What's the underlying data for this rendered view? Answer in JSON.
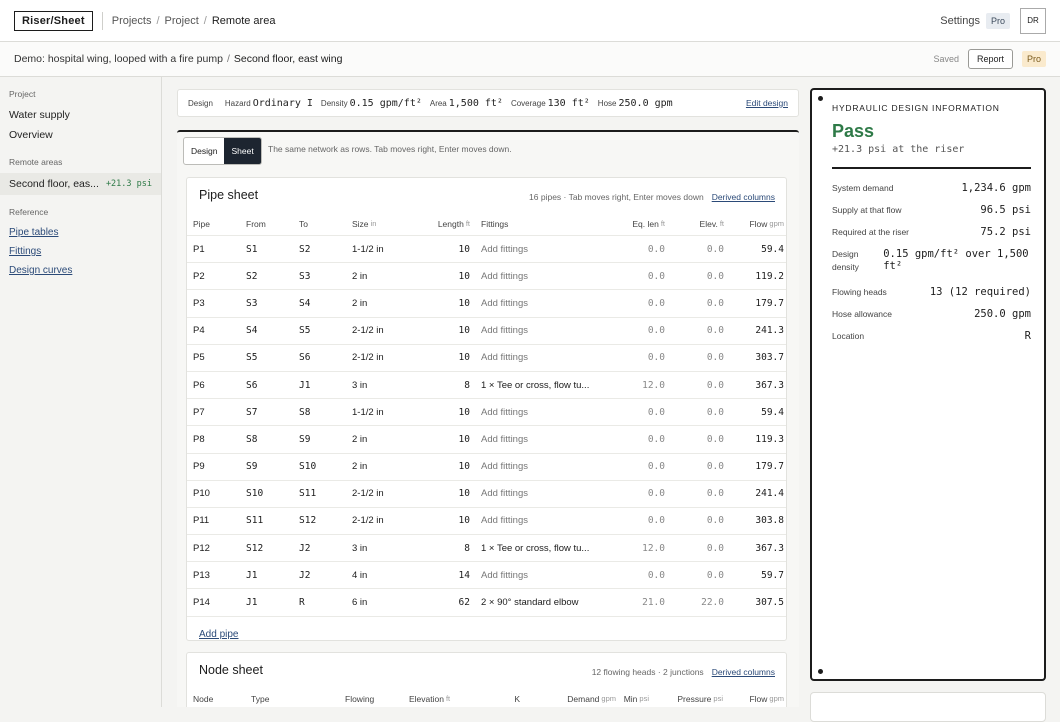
{
  "app": {
    "logo": "Riser/Sheet"
  },
  "breadcrumb": {
    "projects": "Projects",
    "sep": "/",
    "project": "Project",
    "current": "Remote area"
  },
  "topbar": {
    "settings": "Settings",
    "pro": "Pro",
    "avatar": "DR"
  },
  "subbar": {
    "project_name": "Demo: hospital wing, looped with a fire pump",
    "sep": "/",
    "area": "Second floor, east wing",
    "saved": "Saved",
    "report": "Report",
    "pro": "Pro"
  },
  "sidebar": {
    "project_heading": "Project",
    "project_items": [
      "Water supply",
      "Overview"
    ],
    "remote_heading": "Remote areas",
    "active_area": "Second floor, eas...",
    "active_delta": "+21.3 psi",
    "reference_heading": "Reference",
    "reference_links": [
      "Pipe tables",
      "Fittings",
      "Design curves"
    ]
  },
  "design_bar": {
    "design": "Design",
    "hazard_label": "Hazard",
    "hazard": "Ordinary I",
    "density_label": "Density",
    "density": "0.15 gpm/ft²",
    "area_label": "Area",
    "area": "1,500 ft²",
    "coverage_label": "Coverage",
    "coverage": "130 ft²",
    "hose_label": "Hose",
    "hose": "250.0 gpm",
    "edit": "Edit design"
  },
  "tabs": {
    "design": "Design",
    "sheet": "Sheet",
    "hint": "The same network as rows. Tab moves right, Enter moves down."
  },
  "pipe_sheet": {
    "title": "Pipe sheet",
    "meta": "16 pipes · Tab moves right, Enter moves down",
    "derived": "Derived columns",
    "headers": {
      "pipe": "Pipe",
      "from": "From",
      "to": "To",
      "size": "Size",
      "size_unit": "in",
      "length": "Length",
      "length_unit": "ft",
      "fittings": "Fittings",
      "eq": "Eq. len",
      "eq_unit": "ft",
      "elev": "Elev.",
      "elev_unit": "ft",
      "flow": "Flow",
      "flow_unit": "gpm"
    },
    "rows": [
      [
        "P1",
        "S1",
        "S2",
        "1-1/2 in",
        "10",
        "Add fittings",
        "0.0",
        "0.0",
        "59.4"
      ],
      [
        "P2",
        "S2",
        "S3",
        "2 in",
        "10",
        "Add fittings",
        "0.0",
        "0.0",
        "119.2"
      ],
      [
        "P3",
        "S3",
        "S4",
        "2 in",
        "10",
        "Add fittings",
        "0.0",
        "0.0",
        "179.7"
      ],
      [
        "P4",
        "S4",
        "S5",
        "2-1/2 in",
        "10",
        "Add fittings",
        "0.0",
        "0.0",
        "241.3"
      ],
      [
        "P5",
        "S5",
        "S6",
        "2-1/2 in",
        "10",
        "Add fittings",
        "0.0",
        "0.0",
        "303.7"
      ],
      [
        "P6",
        "S6",
        "J1",
        "3 in",
        "8",
        "1 × Tee or cross, flow tu...",
        "12.0",
        "0.0",
        "367.3"
      ],
      [
        "P7",
        "S7",
        "S8",
        "1-1/2 in",
        "10",
        "Add fittings",
        "0.0",
        "0.0",
        "59.4"
      ],
      [
        "P8",
        "S8",
        "S9",
        "2 in",
        "10",
        "Add fittings",
        "0.0",
        "0.0",
        "119.3"
      ],
      [
        "P9",
        "S9",
        "S10",
        "2 in",
        "10",
        "Add fittings",
        "0.0",
        "0.0",
        "179.7"
      ],
      [
        "P10",
        "S10",
        "S11",
        "2-1/2 in",
        "10",
        "Add fittings",
        "0.0",
        "0.0",
        "241.4"
      ],
      [
        "P11",
        "S11",
        "S12",
        "2-1/2 in",
        "10",
        "Add fittings",
        "0.0",
        "0.0",
        "303.8"
      ],
      [
        "P12",
        "S12",
        "J2",
        "3 in",
        "8",
        "1 × Tee or cross, flow tu...",
        "12.0",
        "0.0",
        "367.3"
      ],
      [
        "P13",
        "J1",
        "J2",
        "4 in",
        "14",
        "Add fittings",
        "0.0",
        "0.0",
        "59.7"
      ],
      [
        "P14",
        "J1",
        "R",
        "6 in",
        "62",
        "2 × 90° standard elbow",
        "21.0",
        "22.0",
        "307.5"
      ]
    ],
    "add_pipe": "Add pipe"
  },
  "node_sheet": {
    "title": "Node sheet",
    "meta": "12 flowing heads · 2 junctions",
    "derived": "Derived columns",
    "headers": {
      "node": "Node",
      "type": "Type",
      "flowing": "Flowing",
      "elevation": "Elevation",
      "elevation_unit": "ft",
      "k": "K",
      "demand": "Demand",
      "demand_unit": "gpm",
      "min": "Min",
      "min_unit": "psi",
      "pressure": "Pressure",
      "pressure_unit": "psi",
      "flow": "Flow",
      "flow_unit": "gpm"
    }
  },
  "result_panel": {
    "heading": "HYDRAULIC DESIGN INFORMATION",
    "status": "Pass",
    "margin": "+21.3 psi at the riser",
    "rows": [
      {
        "k": "System demand",
        "v": "1,234.6 gpm"
      },
      {
        "k": "Supply at that flow",
        "v": "96.5 psi"
      },
      {
        "k": "Required at the riser",
        "v": "75.2 psi"
      },
      {
        "k": "Design density",
        "v": "0.15 gpm/ft² over 1,500 ft²"
      },
      {
        "k": "Flowing heads",
        "v": "13 (12 required)"
      },
      {
        "k": "Hose allowance",
        "v": "250.0 gpm"
      },
      {
        "k": "Location",
        "v": "R"
      }
    ]
  },
  "colors": {
    "pass": "#2e7a47",
    "link": "#2b4a78",
    "dark_tab": "#1d2530",
    "pro_gold": "#faeacd"
  }
}
